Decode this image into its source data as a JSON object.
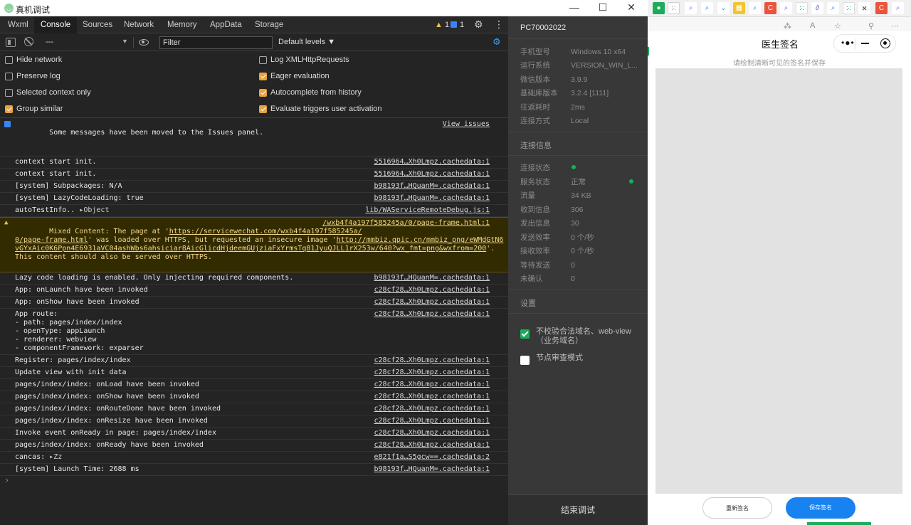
{
  "window": {
    "title": "真机调试",
    "minimize": "—",
    "maximize": "☐",
    "close": "✕"
  },
  "devtools": {
    "tabs": [
      "Wxml",
      "Console",
      "Sources",
      "Network",
      "Memory",
      "AppData",
      "Storage"
    ],
    "active_tab": "Console",
    "warn_count": "1",
    "info_count": "1",
    "toolbar": {
      "context": "---",
      "filter_placeholder": "Filter",
      "levels": "Default levels ▼"
    },
    "settings_left": [
      {
        "label": "Hide network",
        "checked": false
      },
      {
        "label": "Preserve log",
        "checked": false
      },
      {
        "label": "Selected context only",
        "checked": false
      },
      {
        "label": "Group similar",
        "checked": true
      }
    ],
    "settings_right": [
      {
        "label": "Log XMLHttpRequests",
        "checked": false
      },
      {
        "label": "Eager evaluation",
        "checked": true
      },
      {
        "label": "Autocomplete from history",
        "checked": true
      },
      {
        "label": "Evaluate triggers user activation",
        "checked": true
      }
    ]
  },
  "console": {
    "info_message": "Some messages have been moved to the Issues panel.",
    "view_issues": "View issues",
    "rows": [
      {
        "text": "context start init.",
        "source": "5516964…Xh0Lmpz.cachedata:1"
      },
      {
        "text": "context start init.",
        "source": "5516964…Xh0Lmpz.cachedata:1"
      },
      {
        "text": "[system] Subpackages: N/A",
        "source": "b98193f…HQuanM=.cachedata:1"
      },
      {
        "text": "[system] LazyCodeLoading: true",
        "source": "b98193f…HQuanM=.cachedata:1"
      },
      {
        "text": "autoTestInfo..",
        "object": "▸Object",
        "source": "lib/WAServiceRemoteDebug.js:1"
      }
    ],
    "warning": {
      "line1_prefix": "Mixed Content: The page at '",
      "line1_link": "https://servicewechat.com/wxb4f4a197f585245a/",
      "line1_src": "/wxb4f4a197f585245a/0/page-frame.html:1",
      "line2_link": "0/page-frame.html",
      "line2_rest": "' was loaded over HTTPS, but requested an insecure image '",
      "line2_link2": "http://mmbiz.qpic.cn/mmbiz_png/eWMdGtN6",
      "line3_link": "vGYxAic0K6Ppn4E6931aVC04ashWbs6ahsiciar8AicGlicdHjdeemGUjziaFxYrmsTq81JyuQJLL1rX253w/640?wx_fmt=png&wxfrom=200",
      "line3_rest": "'.",
      "line4": "This content should also be served over HTTPS."
    },
    "rows2": [
      {
        "text": "Lazy code loading is enabled. Only injecting required components.",
        "source": "b98193f…HQuanM=.cachedata:1"
      },
      {
        "text": "App: onLaunch have been invoked",
        "source": "c28cf28…Xh0Lmpz.cachedata:1"
      },
      {
        "text": "App: onShow have been invoked",
        "source": "c28cf28…Xh0Lmpz.cachedata:1"
      }
    ],
    "route": {
      "lines": [
        "App route:",
        "- path: pages/index/index",
        "- openType: appLaunch",
        "- renderer: webview",
        "- componentFramework: exparser"
      ],
      "source": "c28cf28…Xh0Lmpz.cachedata:1"
    },
    "rows3": [
      {
        "text": "Register: pages/index/index",
        "source": "c28cf28…Xh0Lmpz.cachedata:1"
      },
      {
        "text": "Update view with init data",
        "source": "c28cf28…Xh0Lmpz.cachedata:1"
      },
      {
        "text": "pages/index/index: onLoad have been invoked",
        "source": "c28cf28…Xh0Lmpz.cachedata:1"
      },
      {
        "text": "pages/index/index: onShow have been invoked",
        "source": "c28cf28…Xh0Lmpz.cachedata:1"
      },
      {
        "text": "pages/index/index: onRouteDone have been invoked",
        "source": "c28cf28…Xh0Lmpz.cachedata:1"
      },
      {
        "text": "pages/index/index: onResize have been invoked",
        "source": "c28cf28…Xh0Lmpz.cachedata:1"
      },
      {
        "text": "Invoke event onReady in page: pages/index/index",
        "source": "c28cf28…Xh0Lmpz.cachedata:1"
      },
      {
        "text": "pages/index/index: onReady have been invoked",
        "source": "c28cf28…Xh0Lmpz.cachedata:1"
      },
      {
        "text": "cancas:",
        "object": "▸Zz",
        "source": "e821f1a…S5gcw==.cachedata:2"
      },
      {
        "text": "[system] Launch Time: 2688 ms",
        "source": "b98193f…HQuanM=.cachedata:1"
      }
    ],
    "prompt": "›"
  },
  "info_panel": {
    "device_id": "PC70002022",
    "props": [
      {
        "k": "手机型号",
        "v": "Windows 10 x64"
      },
      {
        "k": "运行系统",
        "v": "VERSION_WIN_L..."
      },
      {
        "k": "微信版本",
        "v": "3.9.9"
      },
      {
        "k": "基础库版本",
        "v": "3.2.4 [1111]"
      },
      {
        "k": "往返耗时",
        "v": "2ms"
      },
      {
        "k": "连接方式",
        "v": "Local"
      }
    ],
    "conn_title": "连接信息",
    "conn": [
      {
        "k": "连接状态",
        "v": ""
      },
      {
        "k": "服务状态",
        "v": "正常"
      },
      {
        "k": "流量",
        "v": "34 KB"
      },
      {
        "k": "收到信息",
        "v": "306"
      },
      {
        "k": "发出信息",
        "v": "30"
      },
      {
        "k": "发送效率",
        "v": "0 个/秒"
      },
      {
        "k": "接收效率",
        "v": "0 个/秒"
      },
      {
        "k": "等待发送",
        "v": "0"
      },
      {
        "k": "未确认",
        "v": "0"
      }
    ],
    "settings_title": "设置",
    "check1": "不校验合法域名、web-view（业务域名）",
    "check1_on": true,
    "check2": "节点审查模式",
    "check2_on": false,
    "end_button": "结束调试",
    "status_color": "#1aad5a"
  },
  "phone": {
    "title": "医生签名",
    "hint": "请绘制清晰可见的签名并保存",
    "reset_button": "重新签名",
    "save_button": "保存签名",
    "capsule_dots": "•●•",
    "accent": "#1882f0"
  }
}
